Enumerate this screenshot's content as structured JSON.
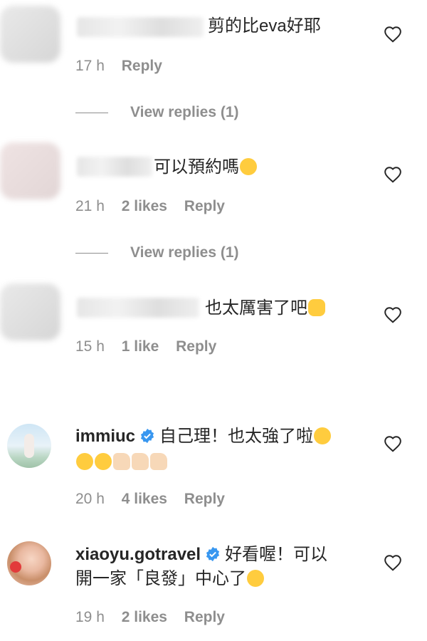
{
  "comments": [
    {
      "text": "剪的比eva好耶",
      "time": "17 h",
      "likes": "",
      "reply": "Reply",
      "view_replies": "View replies (1)"
    },
    {
      "text": "可以預約嗎",
      "time": "21 h",
      "likes": "2 likes",
      "reply": "Reply",
      "view_replies": "View replies (1)"
    },
    {
      "text": "也太厲害了吧",
      "time": "15 h",
      "likes": "1 like",
      "reply": "Reply"
    },
    {
      "username": "immiuc",
      "text": "自己理！也太強了啦",
      "time": "20 h",
      "likes": "4 likes",
      "reply": "Reply"
    },
    {
      "username": "xiaoyu.gotravel",
      "text_line1": "好看喔！可以",
      "text_line2": "開一家「良發」中心了",
      "time": "19 h",
      "likes": "2 likes",
      "reply": "Reply"
    }
  ],
  "colors": {
    "verified": "#3897f0",
    "muted": "#8e8e8e",
    "text": "#262626"
  }
}
